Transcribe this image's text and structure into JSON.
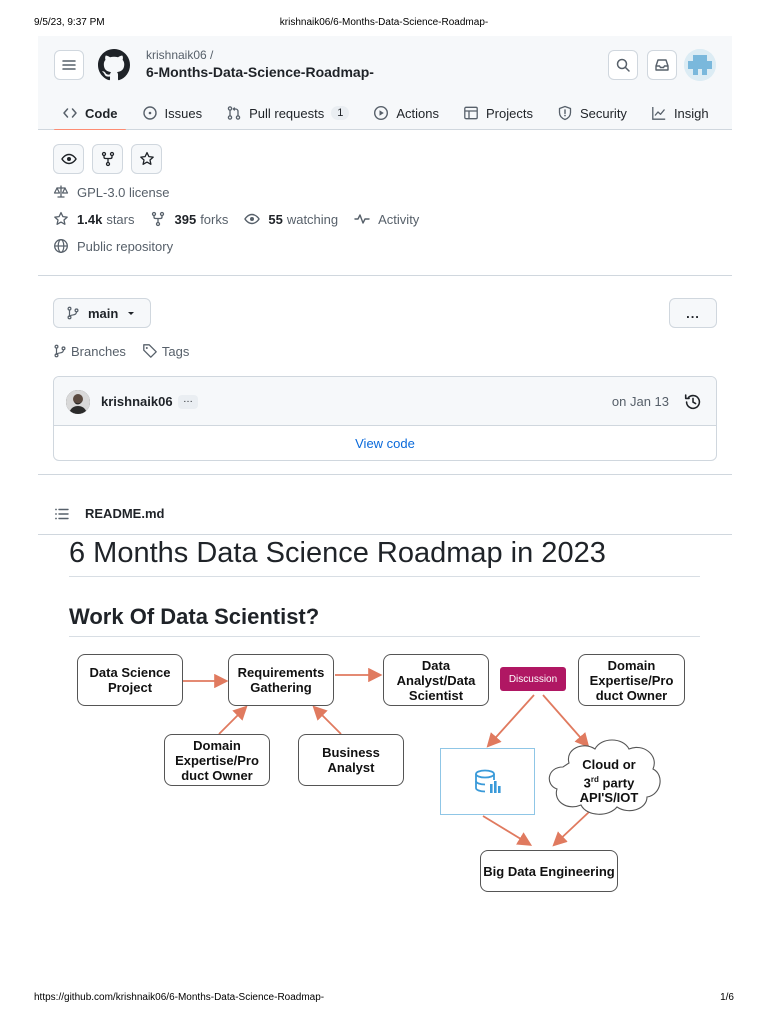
{
  "print": {
    "date": "9/5/23, 9:37 PM",
    "title": "krishnaik06/6-Months-Data-Science-Roadmap-",
    "url": "https://github.com/krishnaik06/6-Months-Data-Science-Roadmap-",
    "page": "1/6"
  },
  "header": {
    "owner": "krishnaik06 /",
    "repo": "6-Months-Data-Science-Roadmap-",
    "tabs": [
      {
        "label": "Code",
        "icon": "code-icon"
      },
      {
        "label": "Issues",
        "icon": "issue-icon"
      },
      {
        "label": "Pull requests",
        "icon": "pull-request-icon",
        "count": "1"
      },
      {
        "label": "Actions",
        "icon": "play-icon"
      },
      {
        "label": "Projects",
        "icon": "table-icon"
      },
      {
        "label": "Security",
        "icon": "shield-icon"
      },
      {
        "label": "Insigh",
        "icon": "graph-icon"
      }
    ]
  },
  "meta": {
    "license": "GPL-3.0 license",
    "stars_count": "1.4k",
    "stars_label": "stars",
    "forks_count": "395",
    "forks_label": "forks",
    "watching_count": "55",
    "watching_label": "watching",
    "activity": "Activity",
    "visibility": "Public repository"
  },
  "branch": {
    "name": "main",
    "more": "...",
    "branches": "Branches",
    "tags": "Tags"
  },
  "commit": {
    "author": "krishnaik06",
    "ellipsis": "…",
    "date": "on Jan 13",
    "view_code": "View code"
  },
  "readme": {
    "filename": "README.md",
    "h1": "6 Months Data Science Roadmap in 2023",
    "h2": "Work Of Data Scientist?"
  },
  "diagram": {
    "data_science_project": "Data Science Project",
    "requirements": "Requirements Gathering",
    "analyst": "Data Analyst/Data Scientist",
    "discussion": "Discussion",
    "domain_right": "Domain Expertise/Pro duct Owner",
    "domain_left": "Domain Expertise/Pro duct Owner",
    "business": "Business Analyst",
    "cloud_line1": "Cloud or",
    "cloud_line2_pre": "3",
    "cloud_line2_sup": "rd",
    "cloud_line2_post": " party",
    "cloud_line3": "API'S/IOT",
    "big_data": "Big Data Engineering"
  },
  "colors": {
    "accent_underline": "#fd8c73",
    "link": "#0969da",
    "discussion": "#b01763",
    "arrow": "#e07a5f"
  }
}
